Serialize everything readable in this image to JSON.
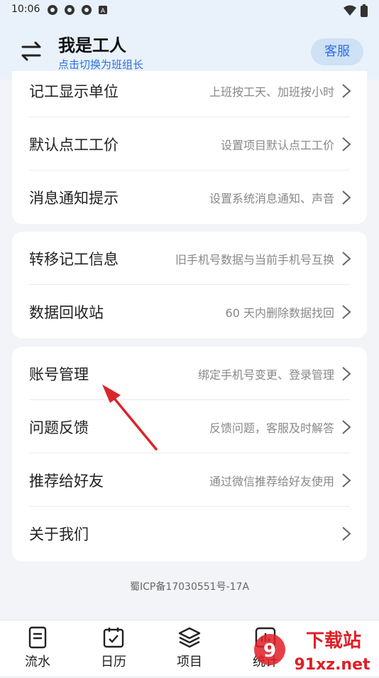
{
  "status_bar": {
    "time": "10:06"
  },
  "header": {
    "title": "我是工人",
    "switch_hint": "点击切换为班组长",
    "service_button": "客服"
  },
  "groups": [
    {
      "items": [
        {
          "label": "记工显示单位",
          "desc": "上班按工天、加班按小时"
        },
        {
          "label": "默认点工工价",
          "desc": "设置项目默认点工工价"
        },
        {
          "label": "消息通知提示",
          "desc": "设置系统消息通知、声音"
        }
      ]
    },
    {
      "items": [
        {
          "label": "转移记工信息",
          "desc": "旧手机号数据与当前手机号互换"
        },
        {
          "label": "数据回收站",
          "desc": "60 天内删除数据找回"
        }
      ]
    },
    {
      "items": [
        {
          "label": "账号管理",
          "desc": "绑定手机号变更、登录管理"
        },
        {
          "label": "问题反馈",
          "desc": "反馈问题，客服及时解答"
        },
        {
          "label": "推荐给好友",
          "desc": "通过微信推荐给好友使用"
        },
        {
          "label": "关于我们",
          "desc": ""
        }
      ]
    }
  ],
  "footer": {
    "icp": "蜀ICP备17030551号-17A"
  },
  "tabs": [
    {
      "label": "流水",
      "icon": "document-icon"
    },
    {
      "label": "日历",
      "icon": "calendar-icon"
    },
    {
      "label": "项目",
      "icon": "layers-icon"
    },
    {
      "label": "统计",
      "icon": "chart-icon"
    }
  ],
  "watermark": {
    "brand": "下载站",
    "domain": "91xz.net"
  },
  "colors": {
    "accent": "#2f6fe0",
    "annotation_arrow": "#d9262b",
    "header_bg": "#e9f2fb"
  }
}
